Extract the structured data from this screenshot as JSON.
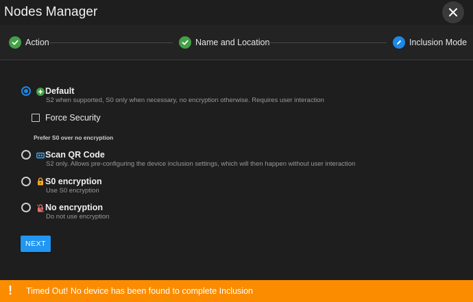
{
  "dialog": {
    "title": "Nodes Manager"
  },
  "stepper": {
    "steps": [
      {
        "label": "Action",
        "state": "complete",
        "icon": "check-icon"
      },
      {
        "label": "Name and Location",
        "state": "complete",
        "icon": "check-icon"
      },
      {
        "label": "Inclusion Mode",
        "state": "active",
        "icon": "pencil-icon"
      }
    ]
  },
  "options": {
    "default": {
      "title": "Default",
      "description": "S2 when supported, S0 only when necessary, no encryption otherwise. Requires user interaction",
      "selected": true,
      "icon": "plus-circle-icon"
    },
    "force_security": {
      "label": "Force Security",
      "checked": false
    },
    "prefer_s0": {
      "label": "Prefer S0 over no encryption"
    },
    "scan_qr": {
      "title": "Scan QR Code",
      "description": "S2 only. Allows pre-configuring the device inclusion settings, which will then happen without user interaction",
      "selected": false,
      "icon": "qrcode-scan-icon"
    },
    "s0": {
      "title": "S0 encryption",
      "description": "Use S0 encryption",
      "selected": false,
      "icon": "lock-icon"
    },
    "none": {
      "title": "No encryption",
      "description": "Do not use encryption",
      "selected": false,
      "icon": "lock-off-icon"
    }
  },
  "actions": {
    "next_label": "NEXT"
  },
  "toast": {
    "icon": "!",
    "message": "Timed Out! No device has been found to complete Inclusion"
  },
  "colors": {
    "background": "#1e1e1e",
    "accent": "#2196f3",
    "success": "#43a047",
    "warning": "#fb8c00"
  }
}
